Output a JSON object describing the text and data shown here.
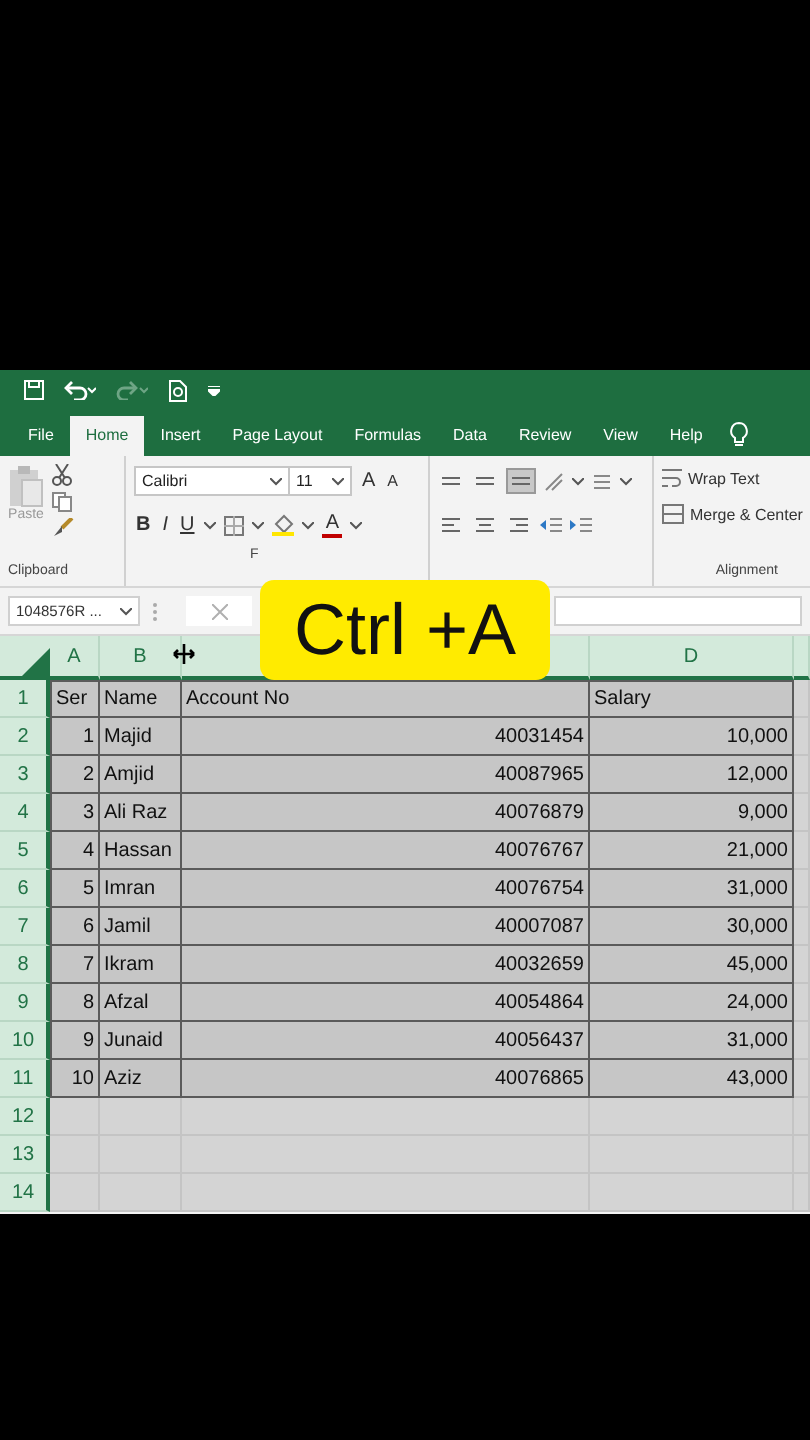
{
  "ribbon_tabs": [
    {
      "label": "File",
      "selected": false
    },
    {
      "label": "Home",
      "selected": true
    },
    {
      "label": "Insert",
      "selected": false
    },
    {
      "label": "Page Layout",
      "selected": false
    },
    {
      "label": "Formulas",
      "selected": false
    },
    {
      "label": "Data",
      "selected": false
    },
    {
      "label": "Review",
      "selected": false
    },
    {
      "label": "View",
      "selected": false
    },
    {
      "label": "Help",
      "selected": false
    }
  ],
  "clipboard": {
    "paste": "Paste",
    "label": "Clipboard"
  },
  "font": {
    "name": "Calibri",
    "size": "11",
    "grow": "A",
    "shrink": "A",
    "bold": "B",
    "italic": "I",
    "underline": "U",
    "color_letter": "A",
    "label": "F"
  },
  "alignment": {
    "bottom_align_selected": true,
    "wrap_text": "Wrap Text",
    "merge": "Merge & Center",
    "label": "Alignment"
  },
  "name_box": "1048576R ...",
  "sheet": {
    "all_selected": true,
    "columns": [
      {
        "header": "A",
        "kind": "number"
      },
      {
        "header": "B",
        "kind": "text"
      },
      {
        "kind": "number"
      },
      {
        "header": "D",
        "kind": "number"
      }
    ],
    "rows": [
      {
        "number": "1",
        "kind": "header",
        "cells": [
          "Ser",
          "Name",
          "Account No",
          "Salary"
        ]
      },
      {
        "number": "2",
        "kind": "data",
        "cells": [
          "1",
          "Majid",
          "40031454",
          "10,000"
        ]
      },
      {
        "number": "3",
        "kind": "data",
        "cells": [
          "2",
          "Amjid",
          "40087965",
          "12,000"
        ]
      },
      {
        "number": "4",
        "kind": "data",
        "cells": [
          "3",
          "Ali Raz",
          "40076879",
          "9,000"
        ]
      },
      {
        "number": "5",
        "kind": "data",
        "cells": [
          "4",
          "Hassan",
          "40076767",
          "21,000"
        ]
      },
      {
        "number": "6",
        "kind": "data",
        "cells": [
          "5",
          "Imran",
          "40076754",
          "31,000"
        ]
      },
      {
        "number": "7",
        "kind": "data",
        "cells": [
          "6",
          "Jamil",
          "40007087",
          "30,000"
        ]
      },
      {
        "number": "8",
        "kind": "data",
        "cells": [
          "7",
          "Ikram",
          "40032659",
          "45,000"
        ]
      },
      {
        "number": "9",
        "kind": "data",
        "cells": [
          "8",
          "Afzal",
          "40054864",
          "24,000"
        ]
      },
      {
        "number": "10",
        "kind": "data",
        "cells": [
          "9",
          "Junaid",
          "40056437",
          "31,000"
        ]
      },
      {
        "number": "11",
        "kind": "data",
        "cells": [
          "10",
          "Aziz",
          "40076865",
          "43,000"
        ]
      },
      {
        "number": "12",
        "kind": "empty"
      },
      {
        "number": "13",
        "kind": "empty"
      },
      {
        "number": "14",
        "kind": "empty"
      }
    ]
  },
  "caption": {
    "text": "Ctrl +A"
  }
}
